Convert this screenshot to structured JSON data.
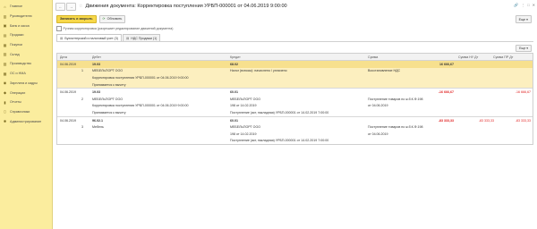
{
  "sidebar": {
    "items": [
      {
        "label": "Главное",
        "icon": "home-icon"
      },
      {
        "label": "Руководителю",
        "icon": "chart-icon"
      },
      {
        "label": "Банк и касса",
        "icon": "bank-icon"
      },
      {
        "label": "Продажи",
        "icon": "cart-icon"
      },
      {
        "label": "Покупки",
        "icon": "basket-icon"
      },
      {
        "label": "Склад",
        "icon": "warehouse-icon"
      },
      {
        "label": "Производство",
        "icon": "factory-icon"
      },
      {
        "label": "ОС и НМА",
        "icon": "assets-icon"
      },
      {
        "label": "Зарплата и кадры",
        "icon": "people-icon"
      },
      {
        "label": "Операции",
        "icon": "operations-icon"
      },
      {
        "label": "Отчеты",
        "icon": "report-icon"
      },
      {
        "label": "Справочники",
        "icon": "book-icon"
      },
      {
        "label": "Администрирование",
        "icon": "gear-icon"
      }
    ]
  },
  "window": {
    "title": "Движения документа: Корректировка поступления УРБП-000001 от 04.06.2019 9:00:00",
    "back": "←",
    "forward": "→",
    "star": "☆"
  },
  "toolbar": {
    "save_close": "Записать и закрыть",
    "refresh": "Обновить",
    "more": "Еще ▾"
  },
  "manual_checkbox": "Ручная корректировка (разрешает редактирование движений документа)",
  "tabs": [
    {
      "label": "Бухгалтерский и налоговый учет (3)"
    },
    {
      "label": "НДС Продажи (1)"
    }
  ],
  "grid": {
    "more": "Еще ▾",
    "headers": {
      "date": "Дата",
      "debit": "Дебет",
      "credit": "Кредит",
      "sum": "Сумма",
      "sum_nu_dt": "Сумма НУ Дт",
      "sum_pr_dt": "Сумма ПР Дт"
    },
    "rows": [
      {
        "date": "04.06.2019",
        "n": "",
        "debit": "19.03",
        "credit": "68.02",
        "sum": "16 666,67",
        "nu": "",
        "pr": "",
        "debit_bold": true,
        "credit_bold": true,
        "sum_bold": true
      },
      {
        "date": "",
        "n": "1",
        "debit": "МЕБЕЛЬПОРТ ООО",
        "credit": "Налог (взносы): начислено / уплачено",
        "sum": "Восстановление НДС",
        "nu": "",
        "pr": ""
      },
      {
        "date": "",
        "n": "",
        "debit": "Корректировка поступления УРБП-000001 от 04.06.2019 9:00:00",
        "credit": "",
        "sum": "",
        "nu": "",
        "pr": ""
      },
      {
        "date": "",
        "n": "",
        "debit": "Принимается к вычету",
        "credit": "",
        "sum": "",
        "nu": "",
        "pr": ""
      },
      {
        "date": "04.06.2019",
        "n": "",
        "debit": "19.03",
        "credit": "60.01",
        "sum": "-16 666,67",
        "nu": "",
        "pr": "-16 666,67",
        "debit_bold": true,
        "credit_bold": true,
        "sum_bold": true
      },
      {
        "date": "",
        "n": "2",
        "debit": "МЕБЕЛЬПОРТ ООО",
        "credit": "МЕБЕЛЬПОРТ ООО",
        "sum": "Поступление товаров по ж.б.К.Ф.198",
        "nu": "",
        "pr": ""
      },
      {
        "date": "",
        "n": "",
        "debit": "Корректировка поступления УРБП-000001 от 04.06.2019 9:00:00",
        "credit": "198 от 14.02.2019",
        "sum": "от 04.06.2019",
        "nu": "",
        "pr": ""
      },
      {
        "date": "",
        "n": "",
        "debit": "Принимается к вычету",
        "credit": "Поступление (акт, накладная) УРБП-000001 от 14.02.2019 7:00:00",
        "sum": "",
        "nu": "",
        "pr": ""
      },
      {
        "date": "04.06.2019",
        "n": "",
        "debit": "96.02.1",
        "credit": "60.01",
        "sum": "-83 333,33",
        "nu": "-83 333,33",
        "pr": "-83 333,33",
        "debit_bold": true,
        "credit_bold": true,
        "sum_bold": true
      },
      {
        "date": "",
        "n": "3",
        "debit": "Мебель",
        "credit": "МЕБЕЛЬПОРТ ООО",
        "sum": "Поступление товаров по ж.б.К.Ф.198",
        "nu": "",
        "pr": ""
      },
      {
        "date": "",
        "n": "",
        "debit": "",
        "credit": "198 от 14.02.2019",
        "sum": "от 04.06.2019",
        "nu": "",
        "pr": ""
      },
      {
        "date": "",
        "n": "",
        "debit": "",
        "credit": "Поступление (акт, накладная) УРБП-000001 от 14.02.2019 7:00:00",
        "sum": "",
        "nu": "",
        "pr": ""
      }
    ]
  },
  "colors": {
    "sidebar_bg": "#fbed9e",
    "primary_button": "#f7d84a",
    "selected_row": "#fcefbf",
    "negative": "#e02020"
  }
}
